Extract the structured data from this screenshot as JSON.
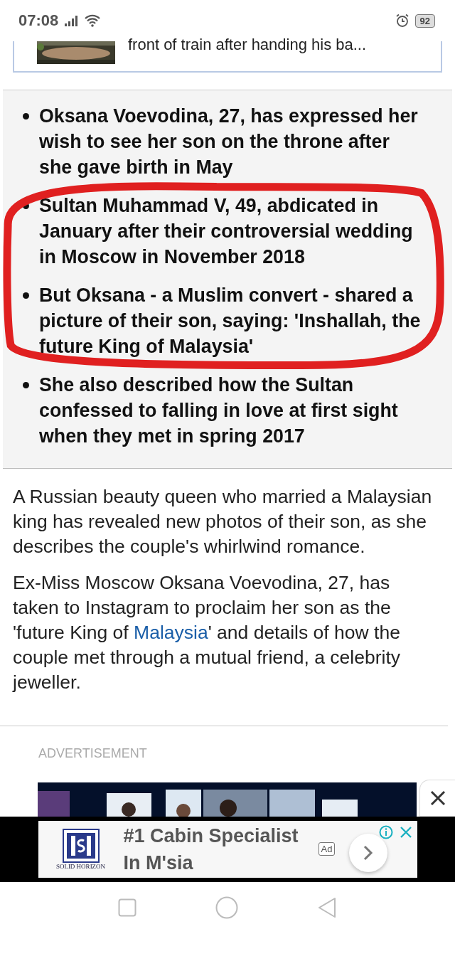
{
  "status_bar": {
    "time": "07:08",
    "battery": "92"
  },
  "related_card": {
    "title": "front of train after handing his ba..."
  },
  "bullets": [
    "Oksana Voevodina, 27, has expressed her wish to see her son on the throne after she gave birth in May",
    "Sultan Muhammad V, 49, abdicated in January after their controversial wedding in Moscow in November 2018",
    "But Oksana - a Muslim convert - shared a picture of their son, saying: 'Inshallah, the future King of Malaysia'",
    "She also described how the Sultan confessed to falling in love at first sight when they met in spring 2017"
  ],
  "paragraphs": [
    {
      "segments": [
        {
          "kind": "plain",
          "text": "A Russian beauty queen who married a Malaysian king has revealed new photos of their son, as she describes the couple's whirlwind romance."
        }
      ]
    },
    {
      "segments": [
        {
          "kind": "plain",
          "text": "Ex-Miss Moscow Oksana Voevodina, 27, has taken to Instagram to proclaim her son as the 'future King of "
        },
        {
          "kind": "link",
          "text": "Malaysia"
        },
        {
          "kind": "plain",
          "text": "' and details of how the couple met through a mutual friend, a celebrity jeweller."
        }
      ]
    }
  ],
  "advertisement_label": "ADVERTISEMENT",
  "ad_banner": {
    "logo_text": "SOLID HORIZON",
    "headline": "#1 Cabin Specialist In M'sia",
    "badge": "Ad"
  }
}
